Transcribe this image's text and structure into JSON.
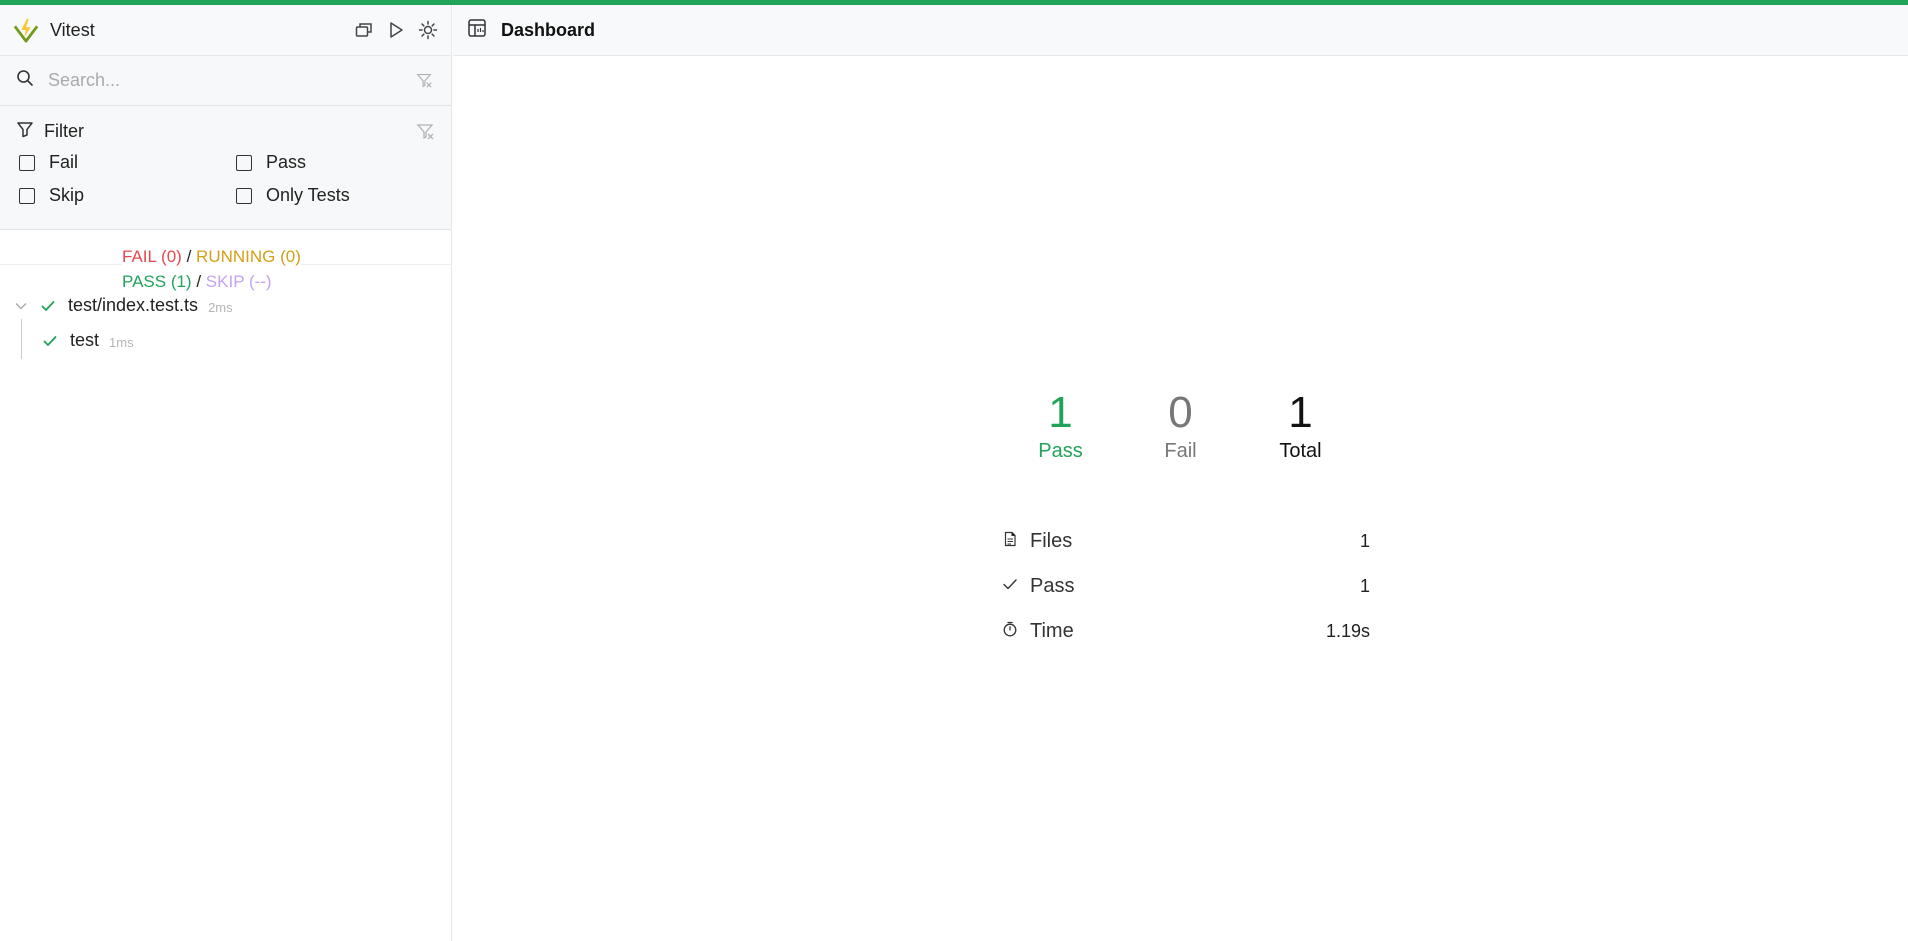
{
  "colors": {
    "accent": "#22a35a",
    "fail": "#e5484d",
    "running": "#d4a017",
    "skip": "#c4a3f0"
  },
  "app": {
    "title": "Vitest"
  },
  "header_icons": [
    "collapse-all-icon",
    "play-icon",
    "theme-toggle-icon"
  ],
  "search": {
    "placeholder": "Search..."
  },
  "filter": {
    "title": "Filter",
    "options": [
      "Fail",
      "Pass",
      "Skip",
      "Only Tests"
    ]
  },
  "summary": {
    "fail": "FAIL (0)",
    "running": "RUNNING (0)",
    "pass": "PASS (1)",
    "skip": "SKIP (--)",
    "separator": "/"
  },
  "tree": {
    "file": {
      "name": "test/index.test.ts",
      "duration": "2ms"
    },
    "test": {
      "name": "test",
      "duration": "1ms"
    }
  },
  "main": {
    "title": "Dashboard",
    "stats": {
      "pass": {
        "value": "1",
        "label": "Pass"
      },
      "fail": {
        "value": "0",
        "label": "Fail"
      },
      "total": {
        "value": "1",
        "label": "Total"
      }
    },
    "details": [
      {
        "label": "Files",
        "value": "1",
        "icon": "file-icon"
      },
      {
        "label": "Pass",
        "value": "1",
        "icon": "check-icon"
      },
      {
        "label": "Time",
        "value": "1.19s",
        "icon": "timer-icon"
      }
    ]
  }
}
